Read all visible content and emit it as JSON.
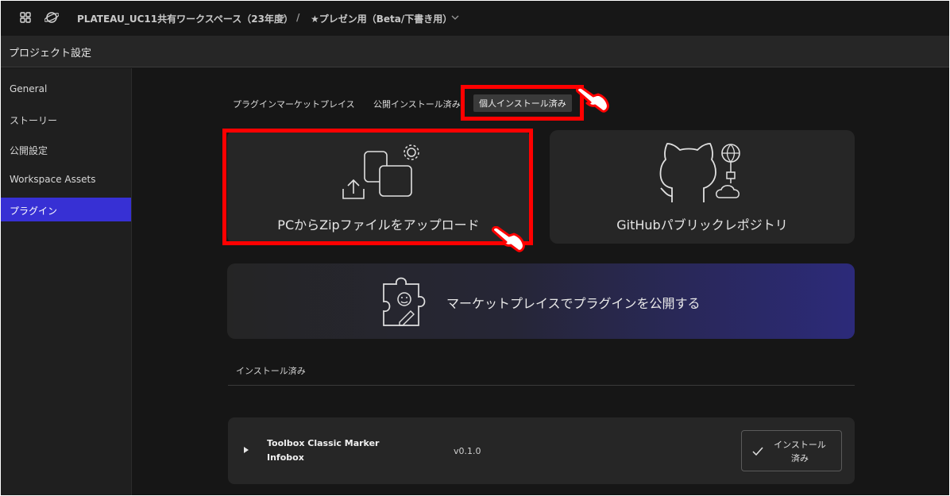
{
  "topbar": {
    "workspace": "PLATEAU_UC11共有ワークスペース（23年度）",
    "separator": "/",
    "project": "★プレゼン用（Beta/下書き用）"
  },
  "page": {
    "title": "プロジェクト設定"
  },
  "sidebar": {
    "items": [
      {
        "label": "General"
      },
      {
        "label": "ストーリー"
      },
      {
        "label": "公開設定"
      },
      {
        "label": "Workspace Assets"
      },
      {
        "label": "プラグイン",
        "active": true
      }
    ]
  },
  "tabs": [
    {
      "label": "プラグインマーケットプレイス"
    },
    {
      "label": "公開インストール済み"
    },
    {
      "label": "個人インストール済み",
      "selected": true
    }
  ],
  "cards": {
    "upload_zip": "PCからZipファイルをアップロード",
    "github": "GitHubパブリックレポジトリ",
    "marketplace_publish": "マーケットプレイスでプラグインを公開する"
  },
  "installed": {
    "section_title": "インストール済み",
    "plugins": [
      {
        "name_line1": "Toolbox Classic Marker",
        "name_line2": "Infobox",
        "version": "v0.1.0",
        "status_line1": "インストール",
        "status_line2": "済み"
      }
    ]
  },
  "colors": {
    "accent": "#3730d4",
    "highlight_box": "#ff0000",
    "background": "#161616"
  }
}
